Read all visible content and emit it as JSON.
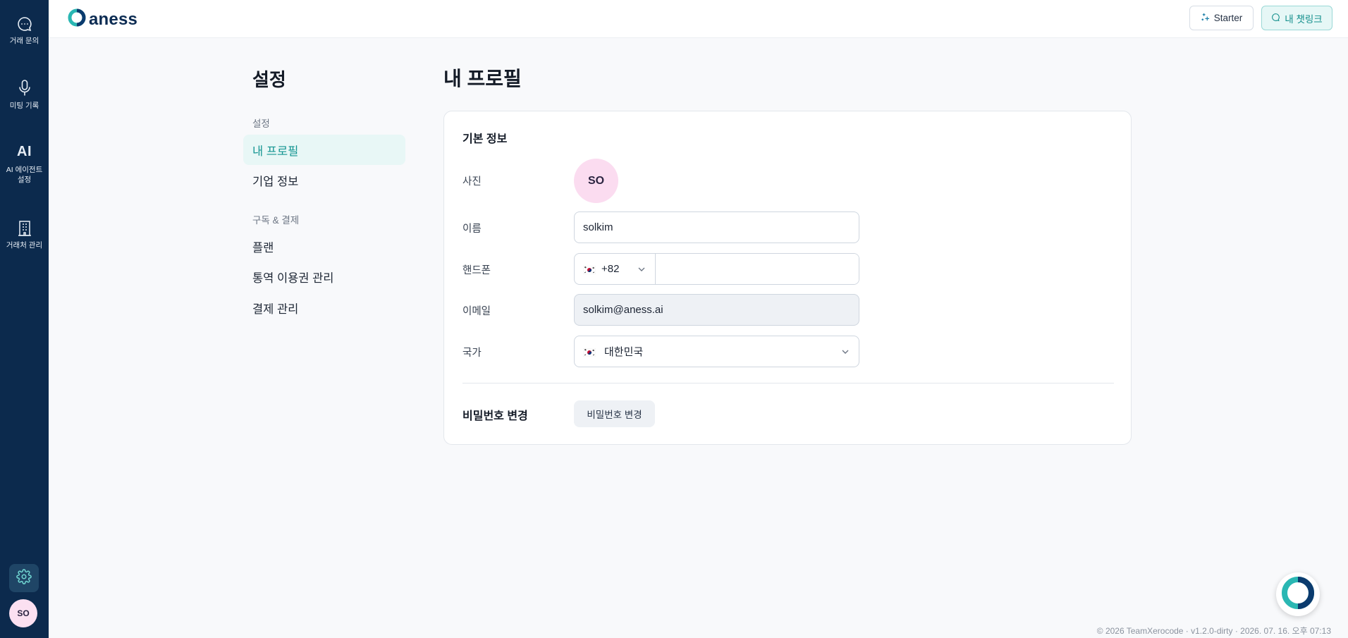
{
  "rail": {
    "items": [
      {
        "label": "거래 문의",
        "icon": "chat-bubble-icon"
      },
      {
        "label": "미팅 기록",
        "icon": "microphone-icon"
      },
      {
        "label": "AI 에이전트\n설정",
        "icon": "ai-icon",
        "glyph": "AI"
      },
      {
        "label": "거래처 관리",
        "icon": "building-icon"
      }
    ],
    "settings_icon": "gear-icon",
    "avatar": "SO"
  },
  "header": {
    "logo_text": "aness",
    "starter_label": "Starter",
    "chatlink_label": "내 챗링크"
  },
  "settings_nav": {
    "title": "설정",
    "groups": [
      {
        "label": "설정",
        "items": [
          "내 프로필",
          "기업 정보"
        ]
      },
      {
        "label": "구독 & 결제",
        "items": [
          "플랜",
          "통역 이용권 관리",
          "결제 관리"
        ]
      }
    ],
    "active": "내 프로필"
  },
  "main": {
    "title": "내 프로필",
    "section_title": "기본 정보",
    "fields": {
      "photo_label": "사진",
      "photo_initials": "SO",
      "name_label": "이름",
      "name_value": "solkim",
      "phone_label": "핸드폰",
      "phone_country_code": "+82",
      "phone_value": "",
      "email_label": "이메일",
      "email_value": "solkim@aness.ai",
      "country_label": "국가",
      "country_value": "대한민국"
    },
    "password": {
      "label": "비밀번호 변경",
      "button_label": "비밀번호 변경"
    }
  },
  "footer": {
    "text": "© 2026 TeamXerocode · v1.2.0-dirty · 2026. 07. 16. 오후 07:13"
  },
  "colors": {
    "rail_bg": "#0c2a4d",
    "accent": "#149592",
    "active_bg": "#e8f7f6",
    "avatar_bg": "#fbdcf0"
  }
}
